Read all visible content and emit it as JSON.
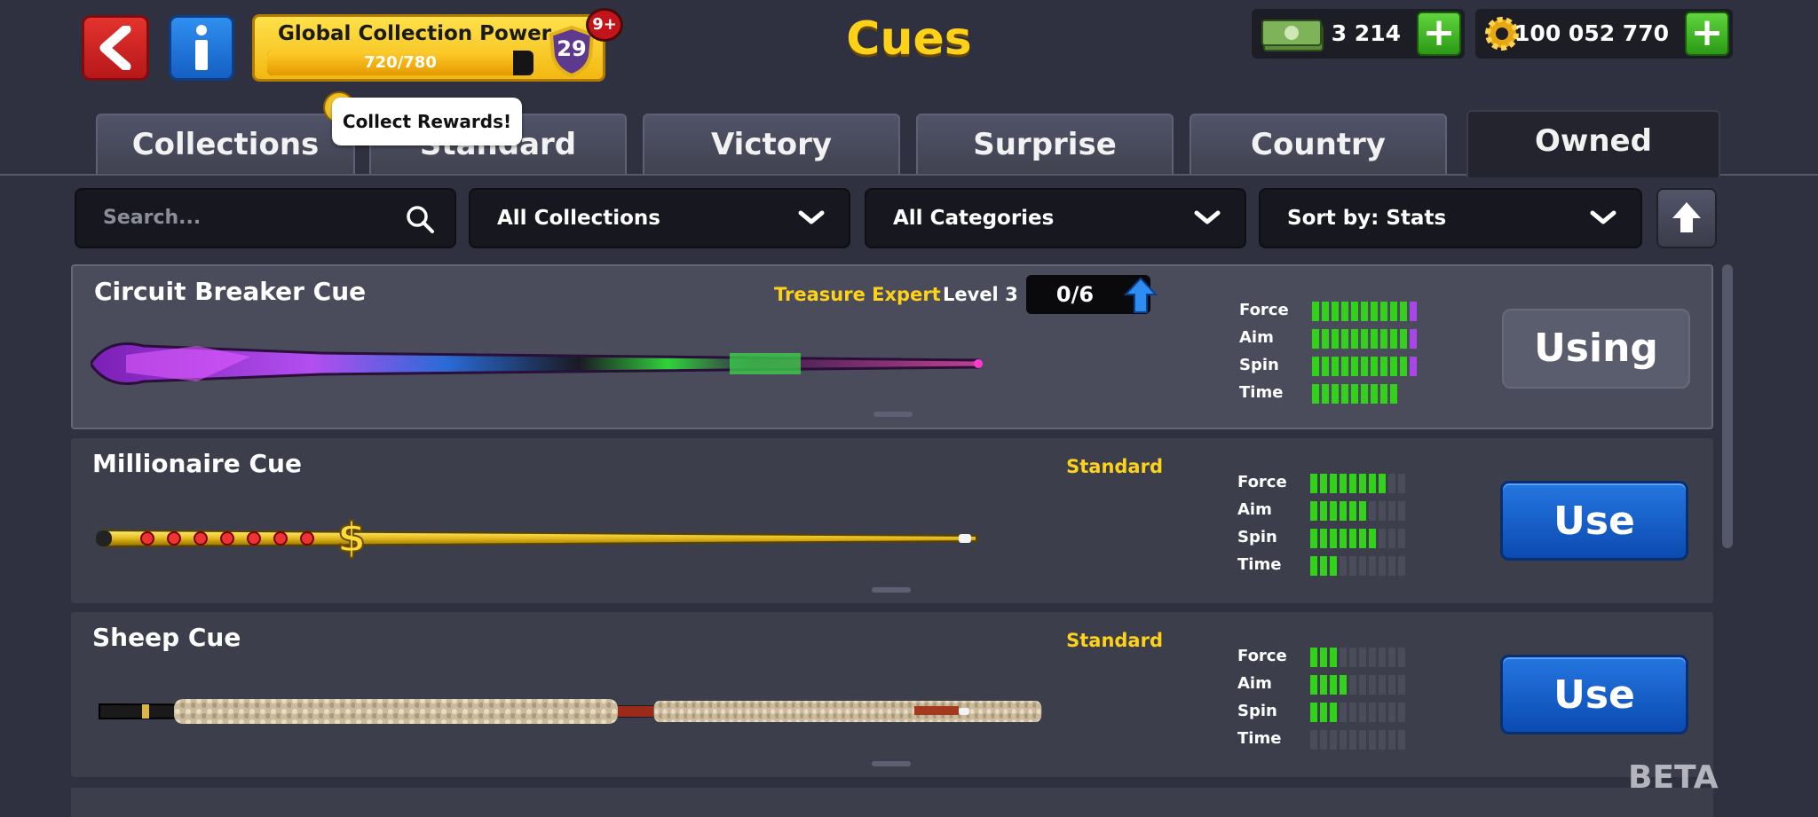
{
  "header": {
    "title": "Cues",
    "back_icon": "back-arrow-icon",
    "info_icon": "info-icon",
    "collection_power": {
      "label": "Global Collection Power",
      "progress_text": "720/780",
      "progress_fraction": 0.923,
      "level": "29",
      "notification_badge": "9+"
    },
    "cash": {
      "amount": "3 214",
      "icon": "cash-stack-icon",
      "add_icon": "plus-icon"
    },
    "coins": {
      "amount": "100 052 770",
      "icon": "coin-gear-icon",
      "add_icon": "plus-icon"
    }
  },
  "tooltip": {
    "text": "Collect Rewards!"
  },
  "tabs": [
    {
      "label": "Collections",
      "active": false
    },
    {
      "label": "Standard",
      "active": false
    },
    {
      "label": "Victory",
      "active": false
    },
    {
      "label": "Surprise",
      "active": false
    },
    {
      "label": "Country",
      "active": false
    },
    {
      "label": "Owned",
      "active": true
    }
  ],
  "filters": {
    "search_placeholder": "Search...",
    "collections": "All Collections",
    "categories": "All Categories",
    "sort": "Sort by: Stats",
    "sort_direction_icon": "arrow-up-icon"
  },
  "stat_labels": [
    "Force",
    "Aim",
    "Spin",
    "Time"
  ],
  "cues": [
    {
      "name": "Circuit Breaker Cue",
      "category": "Treasure Expert",
      "level_text": "Level 3",
      "progress": "0/6",
      "stats": {
        "force": 10,
        "aim": 10,
        "spin": 10,
        "time": 9
      },
      "upgraded": {
        "force": 1,
        "aim": 1,
        "spin": 1,
        "time": 0
      },
      "action": "Using",
      "selected": true
    },
    {
      "name": "Millionaire Cue",
      "category": "Standard",
      "stats": {
        "force": 8,
        "aim": 6,
        "spin": 7,
        "time": 3
      },
      "action": "Use",
      "selected": false
    },
    {
      "name": "Sheep Cue",
      "category": "Standard",
      "stats": {
        "force": 3,
        "aim": 4,
        "spin": 3,
        "time": 0
      },
      "action": "Use",
      "selected": false
    }
  ],
  "watermark": "BETA",
  "colors": {
    "accent_yellow": "#ffd21a",
    "stat_green": "#32d21a",
    "stat_purple": "#a947e6",
    "use_button_blue": "#1560cc",
    "background": "#2f3140"
  }
}
